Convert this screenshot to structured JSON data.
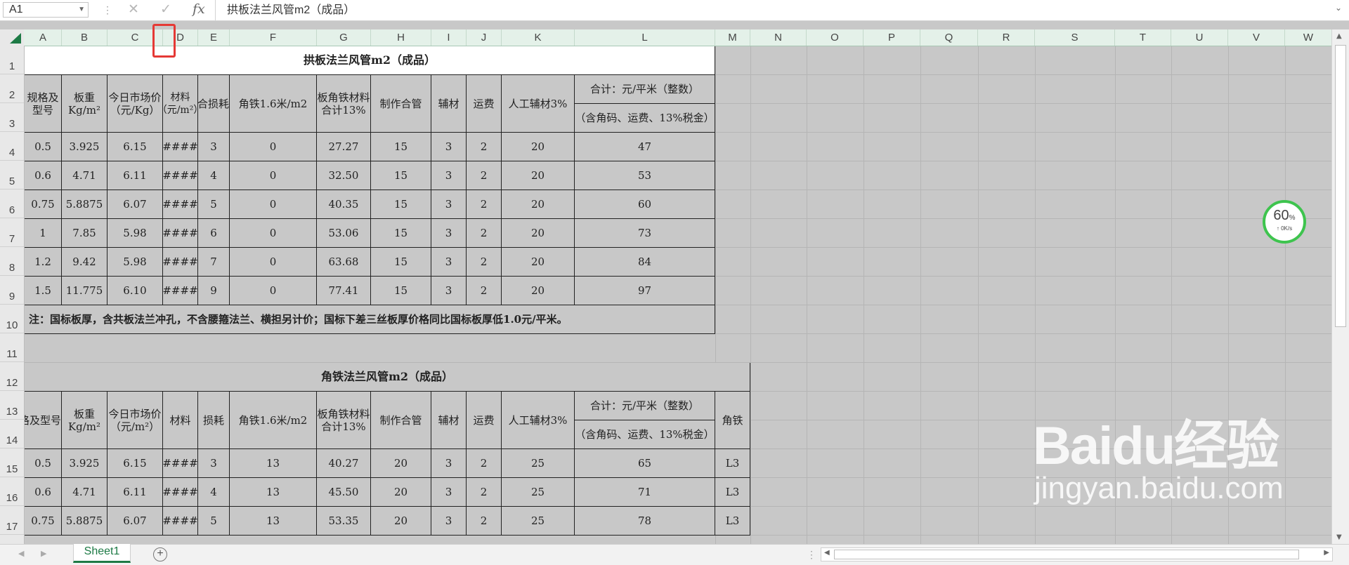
{
  "formula_bar": {
    "name_box": "A1",
    "fx_label": "fx",
    "content": "拱板法兰风管m2（成品）"
  },
  "columns": [
    "A",
    "B",
    "C",
    "D",
    "E",
    "F",
    "G",
    "H",
    "I",
    "J",
    "K",
    "L",
    "M",
    "N",
    "O",
    "P",
    "Q",
    "R",
    "S",
    "T",
    "U",
    "V",
    "W"
  ],
  "rows": [
    "1",
    "2",
    "3",
    "4",
    "5",
    "6",
    "7",
    "8",
    "9",
    "10",
    "11",
    "12",
    "13",
    "14",
    "15",
    "16",
    "17"
  ],
  "table1": {
    "title": "拱板法兰风管m2（成品）",
    "headers": {
      "spec": "规格及型号",
      "plate_weight": "板重Kg/m²",
      "market_price": "今日市场价 （元/Kg）",
      "material": "材料（元/m²）",
      "loss": "综合损耗",
      "angle_iron": "角铁1.6米/m2",
      "plate_angle": "板角铁材料合计13%",
      "fabrication": "制作合管",
      "accessory": "辅材",
      "freight": "运费",
      "labor": "人工辅材3%",
      "total_line1": "合计：元/平米（整数）",
      "total_line2": "（含角码、运费、13%税金）"
    },
    "rows": [
      [
        "0.5",
        "3.925",
        "6.15",
        "####",
        "3",
        "0",
        "27.27",
        "15",
        "3",
        "2",
        "20",
        "47"
      ],
      [
        "0.6",
        "4.71",
        "6.11",
        "####",
        "4",
        "0",
        "32.50",
        "15",
        "3",
        "2",
        "20",
        "53"
      ],
      [
        "0.75",
        "5.8875",
        "6.07",
        "####",
        "5",
        "0",
        "40.35",
        "15",
        "3",
        "2",
        "20",
        "60"
      ],
      [
        "1",
        "7.85",
        "5.98",
        "####",
        "6",
        "0",
        "53.06",
        "15",
        "3",
        "2",
        "20",
        "73"
      ],
      [
        "1.2",
        "9.42",
        "5.98",
        "####",
        "7",
        "0",
        "63.68",
        "15",
        "3",
        "2",
        "20",
        "84"
      ],
      [
        "1.5",
        "11.775",
        "6.10",
        "####",
        "9",
        "0",
        "77.41",
        "15",
        "3",
        "2",
        "20",
        "97"
      ]
    ],
    "note": "注：国标板厚，含共板法兰冲孔，不含腰箍法兰、横担另计价；国标下差三丝板厚价格同比国标板厚低1.0元/平米。"
  },
  "table2": {
    "title": "角铁法兰风管m2（成品）",
    "headers": {
      "spec": "规格及型号",
      "plate_weight": "板重Kg/m²",
      "market_price": "今日市场价 （元/m²）",
      "material": "材料",
      "loss": "损耗",
      "angle_iron": "角铁1.6米/m2",
      "plate_angle": "板角铁材料合计13%",
      "fabrication": "制作合管",
      "accessory": "辅材",
      "freight": "运费",
      "labor": "人工辅材3%",
      "total_line1": "合计：元/平米（整数）",
      "total_line2": "（含角码、运费、13%税金）",
      "angle": "角铁"
    },
    "rows": [
      [
        "0.5",
        "3.925",
        "6.15",
        "####",
        "3",
        "13",
        "40.27",
        "20",
        "3",
        "2",
        "25",
        "65",
        "L3"
      ],
      [
        "0.6",
        "4.71",
        "6.11",
        "####",
        "4",
        "13",
        "45.50",
        "20",
        "3",
        "2",
        "25",
        "71",
        "L3"
      ],
      [
        "0.75",
        "5.8875",
        "6.07",
        "####",
        "5",
        "13",
        "53.35",
        "20",
        "3",
        "2",
        "25",
        "78",
        "L3"
      ]
    ]
  },
  "speed_widget": {
    "percent": "60",
    "unit": "%",
    "rate": "0K/s"
  },
  "sheet_tab": "Sheet1",
  "add_sheet": "+",
  "watermark": {
    "main": "Baidu经验",
    "sub": "jingyan.baidu.com"
  }
}
